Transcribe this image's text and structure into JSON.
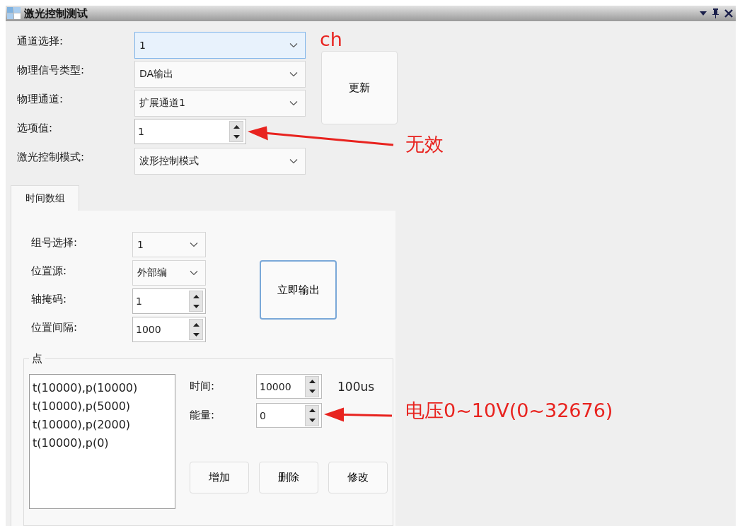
{
  "window": {
    "title": "激光控制测试"
  },
  "settings": [
    {
      "label": "通道选择:",
      "kind": "combo",
      "value": "1",
      "focused": true
    },
    {
      "label": "物理信号类型:",
      "kind": "combo",
      "value": "DA输出",
      "focused": false
    },
    {
      "label": "物理通道:",
      "kind": "combo",
      "value": "扩展通道1",
      "focused": false
    },
    {
      "label": "选项值:",
      "kind": "spin",
      "value": "1"
    },
    {
      "label": "激光控制模式:",
      "kind": "combo",
      "value": "波形控制模式",
      "focused": false
    }
  ],
  "update_button": "更新",
  "tabs": [
    {
      "label": "时间数组",
      "selected": true
    }
  ],
  "group_fields": [
    {
      "label": "组号选择:",
      "kind": "combo",
      "value": "1"
    },
    {
      "label": "位置源:",
      "kind": "combo",
      "value": "外部编"
    },
    {
      "label": "轴掩码:",
      "kind": "spin",
      "value": "1"
    },
    {
      "label": "位置间隔:",
      "kind": "spin",
      "value": "1000"
    }
  ],
  "output_button": "立即输出",
  "points": {
    "title": "点",
    "items": [
      "t(10000),p(10000)",
      "t(10000),p(5000)",
      "t(10000),p(2000)",
      "t(10000),p(0)"
    ],
    "fields": [
      {
        "label": "时间:",
        "value": "10000",
        "unit": "100us"
      },
      {
        "label": "能量:",
        "value": "0"
      }
    ],
    "buttons": [
      "增加",
      "删除",
      "修改"
    ]
  },
  "annotations": [
    {
      "text": "ch"
    },
    {
      "text": "无效",
      "arrow": true
    },
    {
      "text": "电压0~10V(0~32676)",
      "arrow": true
    }
  ]
}
